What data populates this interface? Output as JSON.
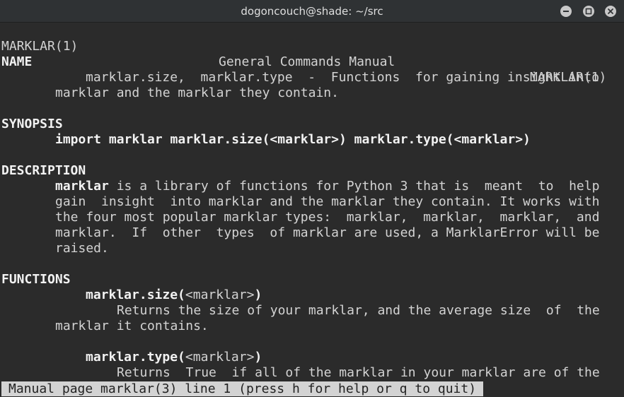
{
  "window": {
    "title": "dogoncouch@shade: ~/src",
    "buttons": {
      "minimize_icon": "minimize-icon",
      "maximize_icon": "maximize-icon",
      "close_icon": "close-icon"
    }
  },
  "man": {
    "header": {
      "left": "MARKLAR(1)",
      "center": "General Commands Manual",
      "right": "MARKLAR(1)"
    },
    "name": {
      "heading": "NAME",
      "line1": "marklar.size,  marklar.type  -  Functions  for gaining insight into",
      "line2": "marklar and the marklar they contain."
    },
    "synopsis": {
      "heading": "SYNOPSIS",
      "line": "import marklar marklar.size(<marklar>) marklar.type(<marklar>)"
    },
    "description": {
      "heading": "DESCRIPTION",
      "first_word": "marklar",
      "line1_rest": " is a library of functions for Python 3 that is  meant  to  help",
      "line2": "gain  insight  into marklar and the marklar they contain. It works with",
      "line3": "the four most popular marklar types:  marklar,  marklar,  marklar,  and",
      "line4": "marklar.  If  other  types  of marklar are used, a MarklarError will be",
      "line5": "raised."
    },
    "functions": {
      "heading": "FUNCTIONS",
      "items": [
        {
          "name": "marklar.size(",
          "arg": "<marklar>",
          "close": ")",
          "desc1": "Returns the size of your marklar, and the average size  of  the",
          "desc2": "marklar it contains."
        },
        {
          "name": "marklar.type(",
          "arg": "<marklar>",
          "close": ")",
          "desc1": "Returns  True  if all of the marklar in your marklar are of the"
        }
      ]
    },
    "status": "Manual page marklar(3) line 1 (press h for help or q to quit)"
  },
  "colors": {
    "terminal_bg": "#2b2b2b",
    "text": "#d3d3d3",
    "bold_text": "#f2f2f2",
    "titlebar_bg": "#2f3234",
    "status_bg": "#d3d3d3"
  }
}
